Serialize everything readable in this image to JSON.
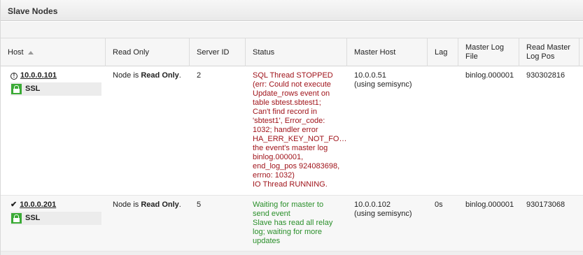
{
  "panel": {
    "title": "Slave Nodes"
  },
  "table": {
    "columns": [
      "Host",
      "Read Only",
      "Server ID",
      "Status",
      "Master Host",
      "Lag",
      "Master Log\nFile",
      "Read Master\nLog Pos"
    ],
    "rows": [
      {
        "host": "10.0.0.101",
        "host_icon": "warning-circle-icon",
        "ssl": "SSL",
        "read_only_prefix": "Node is ",
        "read_only_bold": "Read Only",
        "read_only_suffix": ".",
        "server_id": "2",
        "status": "SQL Thread STOPPED\n(err: Could not execute\nUpdate_rows event on\ntable sbtest.sbtest1;\nCan't find record in\n'sbtest1', Error_code:\n1032; handler error\nHA_ERR_KEY_NOT_FO…\nthe event's master log\nbinlog.000001,\nend_log_pos 924083698,\nerrno: 1032)\nIO Thread RUNNING.",
        "status_color": "#a0141b",
        "master_host": "10.0.0.51\n(using semisync)",
        "lag": "",
        "master_log_file": "binlog.000001",
        "read_master_log_pos": "930302816"
      },
      {
        "host": "10.0.0.201",
        "host_icon": "checkmark-icon",
        "ssl": "SSL",
        "read_only_prefix": "Node is ",
        "read_only_bold": "Read Only",
        "read_only_suffix": ".",
        "server_id": "5",
        "status": "Waiting for master to\nsend event\nSlave has read all relay\nlog; waiting for more\nupdates",
        "status_color": "#2a8f2a",
        "master_host": "10.0.0.102\n(using semisync)",
        "lag": "0s",
        "master_log_file": "binlog.000001",
        "read_master_log_pos": "930173068"
      }
    ]
  }
}
